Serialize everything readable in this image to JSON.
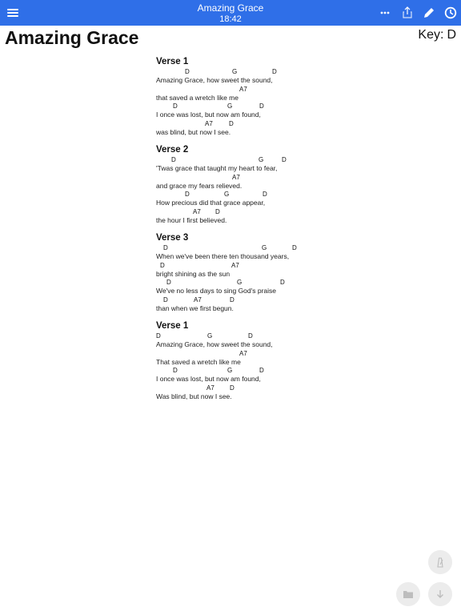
{
  "app": {
    "title": "Amazing Grace",
    "time": "18:42"
  },
  "toolbar": {
    "icons": [
      "menu-icon",
      "more-icon",
      "share-icon",
      "edit-icon",
      "clock-icon"
    ]
  },
  "song": {
    "title": "Amazing Grace",
    "key_label": "Key:",
    "key_value": "D"
  },
  "sections": [
    {
      "title": "Verse 1",
      "lines": [
        {
          "chords": [
            {
              "chord": "D",
              "at": 36
            },
            {
              "chord": "G",
              "at": 95
            },
            {
              "chord": "D",
              "at": 145
            }
          ],
          "lyric": "Amazing Grace, how sweet the sound,"
        },
        {
          "chords": [
            {
              "chord": "A7",
              "at": 104
            }
          ],
          "lyric": "that saved a wretch like me"
        },
        {
          "chords": [
            {
              "chord": "D",
              "at": 21
            },
            {
              "chord": "G",
              "at": 89
            },
            {
              "chord": "D",
              "at": 129
            }
          ],
          "lyric": "I once was lost, but now am found,"
        },
        {
          "chords": [
            {
              "chord": "A7",
              "at": 61
            },
            {
              "chord": "D",
              "at": 91
            }
          ],
          "lyric": "was blind, but now I see."
        }
      ]
    },
    {
      "title": "Verse 2",
      "lines": [
        {
          "chords": [
            {
              "chord": "D",
              "at": 19
            },
            {
              "chord": "G",
              "at": 128
            },
            {
              "chord": "D",
              "at": 157
            }
          ],
          "lyric": "'Twas grace that taught my heart to fear,"
        },
        {
          "chords": [
            {
              "chord": "A7",
              "at": 95
            }
          ],
          "lyric": "and grace my fears relieved."
        },
        {
          "chords": [
            {
              "chord": "D",
              "at": 36
            },
            {
              "chord": "G",
              "at": 85
            },
            {
              "chord": "D",
              "at": 133
            }
          ],
          "lyric": "How precious did that grace appear,"
        },
        {
          "chords": [
            {
              "chord": "A7",
              "at": 46
            },
            {
              "chord": "D",
              "at": 74
            }
          ],
          "lyric": "the hour I first believed."
        }
      ]
    },
    {
      "title": "Verse 3",
      "lines": [
        {
          "chords": [
            {
              "chord": "D",
              "at": 9
            },
            {
              "chord": "G",
              "at": 132
            },
            {
              "chord": "D",
              "at": 170
            }
          ],
          "lyric": "When we've been there ten thousand years,"
        },
        {
          "chords": [
            {
              "chord": "D",
              "at": 5
            },
            {
              "chord": "A7",
              "at": 94
            }
          ],
          "lyric": "bright shining as the sun"
        },
        {
          "chords": [
            {
              "chord": "D",
              "at": 13
            },
            {
              "chord": "G",
              "at": 101
            },
            {
              "chord": "D",
              "at": 155
            }
          ],
          "lyric": "We've no less days to sing God's praise"
        },
        {
          "chords": [
            {
              "chord": "D",
              "at": 9
            },
            {
              "chord": "A7",
              "at": 47
            },
            {
              "chord": "D",
              "at": 92
            }
          ],
          "lyric": "than when we first begun."
        }
      ]
    },
    {
      "title": "Verse 1",
      "lines": [
        {
          "chords": [
            {
              "chord": "D",
              "at": 0
            },
            {
              "chord": "G",
              "at": 64
            },
            {
              "chord": "D",
              "at": 115
            }
          ],
          "lyric": "Amazing Grace, how sweet the sound,"
        },
        {
          "chords": [
            {
              "chord": "A7",
              "at": 104
            }
          ],
          "lyric": "That saved a wretch like me"
        },
        {
          "chords": [
            {
              "chord": "D",
              "at": 21
            },
            {
              "chord": "G",
              "at": 89
            },
            {
              "chord": "D",
              "at": 129
            }
          ],
          "lyric": "I once was lost, but now am found,"
        },
        {
          "chords": [
            {
              "chord": "A7",
              "at": 63
            },
            {
              "chord": "D",
              "at": 92
            }
          ],
          "lyric": "Was blind, but now I see."
        }
      ]
    }
  ],
  "fabs": [
    "metronome-icon",
    "folder-icon",
    "scroll-down-icon"
  ]
}
